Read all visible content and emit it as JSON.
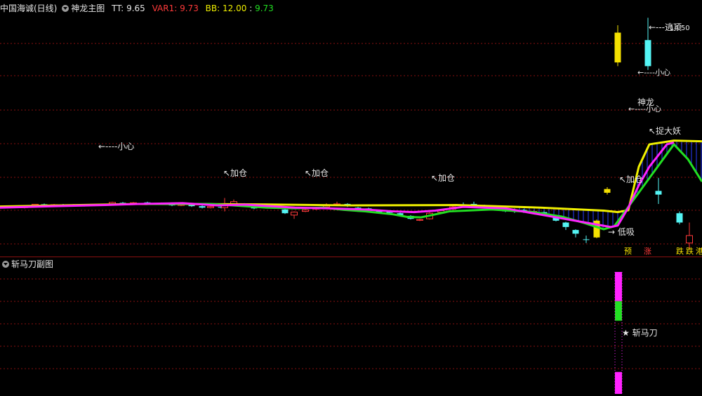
{
  "header": {
    "stock": "中国海诚(日线)",
    "indicator": "神龙主图",
    "tt_label": "TT:",
    "tt_value": "9.65",
    "var1_label": "VAR1:",
    "var1_value": "9.73",
    "bb_label": "BB:",
    "bb_value": "12.00",
    "bb_value2": "9.73"
  },
  "sub": {
    "title": "斩马刀副图",
    "signal_label": "★ 斩马刀"
  },
  "annotations": {
    "xiaoxin1": "←----小心",
    "jiacang1": "↖加仓",
    "jiacang2": "↖加仓",
    "jiacang3": "↖加仓",
    "jiacang4": "↖加仓",
    "dixi": "→ 低吸",
    "shenlong": "神龙",
    "xiaoxin2": "←----小心",
    "xiaoxin3": "←----小心",
    "taopao": "←---逃顶",
    "price_peak": "14.50",
    "zhuodayao": "↖捉大妖",
    "tag_yu": "预",
    "tag_zhang": "涨",
    "tag_die1": "跌",
    "tag_die2": "跌",
    "tag_gang": "港"
  },
  "colors": {
    "up": "#ff3a3a",
    "down": "#54f4f4",
    "limit": "#f4e000",
    "yellow_line": "#f0f000",
    "green_line": "#22e022",
    "magenta_line": "#ff22ff",
    "grid": "#8a1010",
    "text": "#e6e6e6"
  },
  "chart_data": {
    "type": "candlestick",
    "price_range": [
      9.0,
      14.9
    ],
    "candles": [
      {
        "o": 9.72,
        "c": 9.74,
        "h": 9.76,
        "l": 9.7,
        "k": "up"
      },
      {
        "o": 9.73,
        "c": 9.71,
        "h": 9.75,
        "l": 9.69,
        "k": "down"
      },
      {
        "o": 9.7,
        "c": 9.73,
        "h": 9.75,
        "l": 9.68,
        "k": "up"
      },
      {
        "o": 9.74,
        "c": 9.79,
        "h": 9.8,
        "l": 9.72,
        "k": "up"
      },
      {
        "o": 9.79,
        "c": 9.76,
        "h": 9.81,
        "l": 9.74,
        "k": "down"
      },
      {
        "o": 9.75,
        "c": 9.78,
        "h": 9.8,
        "l": 9.73,
        "k": "up"
      },
      {
        "o": 9.78,
        "c": 9.76,
        "h": 9.8,
        "l": 9.74,
        "k": "down"
      },
      {
        "o": 9.76,
        "c": 9.78,
        "h": 9.8,
        "l": 9.74,
        "k": "up"
      },
      {
        "o": 9.77,
        "c": 9.75,
        "h": 9.79,
        "l": 9.73,
        "k": "down"
      },
      {
        "o": 9.76,
        "c": 9.78,
        "h": 9.8,
        "l": 9.74,
        "k": "up"
      },
      {
        "o": 9.8,
        "c": 9.84,
        "h": 9.86,
        "l": 9.78,
        "k": "up"
      },
      {
        "o": 9.83,
        "c": 9.8,
        "h": 9.85,
        "l": 9.78,
        "k": "down"
      },
      {
        "o": 9.81,
        "c": 9.83,
        "h": 9.85,
        "l": 9.79,
        "k": "up"
      },
      {
        "o": 9.84,
        "c": 9.8,
        "h": 9.86,
        "l": 9.78,
        "k": "down"
      },
      {
        "o": 9.8,
        "c": 9.82,
        "h": 9.84,
        "l": 9.78,
        "k": "up"
      },
      {
        "o": 9.82,
        "c": 9.76,
        "h": 9.84,
        "l": 9.74,
        "k": "down"
      },
      {
        "o": 9.76,
        "c": 9.8,
        "h": 9.82,
        "l": 9.74,
        "k": "up"
      },
      {
        "o": 9.79,
        "c": 9.74,
        "h": 9.81,
        "l": 9.72,
        "k": "down"
      },
      {
        "o": 9.74,
        "c": 9.7,
        "h": 9.76,
        "l": 9.68,
        "k": "down"
      },
      {
        "o": 9.7,
        "c": 9.73,
        "h": 9.75,
        "l": 9.68,
        "k": "up"
      },
      {
        "o": 9.72,
        "c": 9.7,
        "h": 9.74,
        "l": 9.68,
        "k": "down"
      },
      {
        "o": 9.7,
        "c": 9.76,
        "h": 9.96,
        "l": 9.6,
        "k": "up"
      },
      {
        "o": 9.78,
        "c": 9.86,
        "h": 9.92,
        "l": 9.76,
        "k": "up"
      },
      {
        "o": 9.8,
        "c": 9.76,
        "h": 9.82,
        "l": 9.74,
        "k": "down"
      },
      {
        "o": 9.72,
        "c": 9.68,
        "h": 9.74,
        "l": 9.66,
        "k": "down"
      },
      {
        "o": 9.7,
        "c": 9.73,
        "h": 9.75,
        "l": 9.68,
        "k": "up"
      },
      {
        "o": 9.74,
        "c": 9.72,
        "h": 9.76,
        "l": 9.7,
        "k": "down"
      },
      {
        "o": 9.65,
        "c": 9.55,
        "h": 9.67,
        "l": 9.53,
        "k": "down"
      },
      {
        "o": 9.58,
        "c": 9.5,
        "h": 9.6,
        "l": 9.4,
        "k": "up"
      },
      {
        "o": 9.6,
        "c": 9.64,
        "h": 9.66,
        "l": 9.58,
        "k": "up"
      },
      {
        "o": 9.66,
        "c": 9.7,
        "h": 9.72,
        "l": 9.64,
        "k": "up"
      },
      {
        "o": 9.72,
        "c": 9.78,
        "h": 9.82,
        "l": 9.7,
        "k": "up"
      },
      {
        "o": 9.76,
        "c": 9.8,
        "h": 9.86,
        "l": 9.74,
        "k": "up"
      },
      {
        "o": 9.8,
        "c": 9.74,
        "h": 9.82,
        "l": 9.72,
        "k": "down"
      },
      {
        "o": 9.7,
        "c": 9.66,
        "h": 9.72,
        "l": 9.64,
        "k": "down"
      },
      {
        "o": 9.68,
        "c": 9.63,
        "h": 9.7,
        "l": 9.61,
        "k": "down"
      },
      {
        "o": 9.62,
        "c": 9.58,
        "h": 9.64,
        "l": 9.56,
        "k": "down"
      },
      {
        "o": 9.6,
        "c": 9.56,
        "h": 9.62,
        "l": 9.54,
        "k": "down"
      },
      {
        "o": 9.55,
        "c": 9.5,
        "h": 9.57,
        "l": 9.48,
        "k": "down"
      },
      {
        "o": 9.48,
        "c": 9.4,
        "h": 9.5,
        "l": 9.38,
        "k": "down"
      },
      {
        "o": 9.36,
        "c": 9.38,
        "h": 9.4,
        "l": 9.34,
        "k": "up"
      },
      {
        "o": 9.4,
        "c": 9.55,
        "h": 9.58,
        "l": 9.38,
        "k": "up"
      },
      {
        "o": 9.58,
        "c": 9.62,
        "h": 9.64,
        "l": 9.56,
        "k": "up"
      },
      {
        "o": 9.66,
        "c": 9.72,
        "h": 9.76,
        "l": 9.64,
        "k": "up"
      },
      {
        "o": 9.74,
        "c": 9.78,
        "h": 9.84,
        "l": 9.72,
        "k": "down"
      },
      {
        "o": 9.8,
        "c": 9.74,
        "h": 9.86,
        "l": 9.72,
        "k": "down"
      },
      {
        "o": 9.76,
        "c": 9.7,
        "h": 9.78,
        "l": 9.68,
        "k": "down"
      },
      {
        "o": 9.7,
        "c": 9.64,
        "h": 9.72,
        "l": 9.62,
        "k": "down"
      },
      {
        "o": 9.66,
        "c": 9.6,
        "h": 9.68,
        "l": 9.58,
        "k": "down"
      },
      {
        "o": 9.62,
        "c": 9.62,
        "h": 9.68,
        "l": 9.56,
        "k": "down"
      },
      {
        "o": 9.64,
        "c": 9.58,
        "h": 9.66,
        "l": 9.56,
        "k": "down"
      },
      {
        "o": 9.6,
        "c": 9.58,
        "h": 9.62,
        "l": 9.56,
        "k": "up"
      },
      {
        "o": 9.58,
        "c": 9.5,
        "h": 9.6,
        "l": 9.48,
        "k": "down"
      },
      {
        "o": 9.48,
        "c": 9.35,
        "h": 9.5,
        "l": 9.33,
        "k": "down"
      },
      {
        "o": 9.3,
        "c": 9.18,
        "h": 9.32,
        "l": 9.1,
        "k": "down"
      },
      {
        "o": 9.1,
        "c": 9.0,
        "h": 9.12,
        "l": 8.9,
        "k": "down"
      },
      {
        "o": 8.85,
        "c": 8.85,
        "h": 8.95,
        "l": 8.75,
        "k": "down"
      },
      {
        "o": 8.9,
        "c": 9.35,
        "h": 9.38,
        "l": 8.88,
        "k": "limit"
      },
      {
        "o": 10.1,
        "c": 10.2,
        "h": 10.25,
        "l": 10.05,
        "k": "limit"
      },
      {
        "o": 13.6,
        "c": 14.4,
        "h": 14.6,
        "l": 13.5,
        "k": "limit"
      },
      {
        "o": 14.2,
        "c": 13.5,
        "h": 14.8,
        "l": 13.4,
        "k": "down"
      },
      {
        "o": 10.15,
        "c": 10.05,
        "h": 10.5,
        "l": 9.8,
        "k": "down"
      },
      {
        "o": 9.55,
        "c": 9.3,
        "h": 9.6,
        "l": 9.25,
        "k": "down"
      },
      {
        "o": 8.75,
        "c": 8.95,
        "h": 9.3,
        "l": 8.6,
        "k": "up"
      }
    ],
    "x_positions": [
      8,
      22,
      35,
      50,
      63,
      77,
      90,
      105,
      120,
      135,
      160,
      175,
      190,
      210,
      230,
      245,
      258,
      273,
      288,
      300,
      315,
      320,
      333,
      348,
      362,
      378,
      392,
      406,
      419,
      435,
      450,
      465,
      480,
      495,
      510,
      525,
      540,
      555,
      570,
      585,
      598,
      612,
      628,
      645,
      660,
      675,
      690,
      705,
      720,
      733,
      746,
      760,
      775,
      792,
      806,
      820,
      835,
      850,
      865,
      880,
      923,
      938,
      968,
      982,
      997
    ],
    "yellow_line": [
      [
        0,
        9.73
      ],
      [
        200,
        9.8
      ],
      [
        350,
        9.79
      ],
      [
        500,
        9.76
      ],
      [
        650,
        9.77
      ],
      [
        770,
        9.7
      ],
      [
        860,
        9.62
      ],
      [
        880,
        9.58
      ],
      [
        895,
        9.63
      ],
      [
        910,
        10.8
      ],
      [
        925,
        11.4
      ],
      [
        960,
        11.5
      ],
      [
        1000,
        11.48
      ]
    ],
    "green_line": [
      [
        210,
        9.8
      ],
      [
        260,
        9.8
      ],
      [
        300,
        9.8
      ],
      [
        380,
        9.7
      ],
      [
        420,
        9.68
      ],
      [
        460,
        9.7
      ],
      [
        490,
        9.64
      ],
      [
        520,
        9.6
      ],
      [
        560,
        9.52
      ],
      [
        580,
        9.45
      ],
      [
        600,
        9.44
      ],
      [
        640,
        9.6
      ],
      [
        700,
        9.65
      ],
      [
        760,
        9.58
      ],
      [
        800,
        9.46
      ],
      [
        830,
        9.3
      ],
      [
        860,
        9.12
      ],
      [
        875,
        9.2
      ],
      [
        960,
        11.4
      ],
      [
        980,
        11.0
      ],
      [
        1000,
        10.4
      ]
    ],
    "magenta_line": [
      [
        0,
        9.7
      ],
      [
        80,
        9.74
      ],
      [
        150,
        9.77
      ],
      [
        200,
        9.8
      ],
      [
        260,
        9.82
      ],
      [
        310,
        9.76
      ],
      [
        350,
        9.78
      ],
      [
        420,
        9.7
      ],
      [
        470,
        9.68
      ],
      [
        520,
        9.65
      ],
      [
        560,
        9.6
      ],
      [
        590,
        9.58
      ],
      [
        620,
        9.62
      ],
      [
        660,
        9.72
      ],
      [
        690,
        9.7
      ],
      [
        720,
        9.68
      ],
      [
        870,
        9.18
      ],
      [
        880,
        9.22
      ],
      [
        895,
        9.7
      ],
      [
        910,
        10.3
      ],
      [
        925,
        10.8
      ],
      [
        950,
        11.4
      ],
      [
        960,
        11.45
      ]
    ],
    "subchart": {
      "bars": [
        {
          "color": "#ff22ff",
          "from": 0.0,
          "to": 0.24
        },
        {
          "color": "#22e022",
          "from": 0.24,
          "to": 0.4
        },
        {
          "color": "#ff22ff",
          "from": 0.82,
          "to": 1.0
        }
      ]
    }
  }
}
